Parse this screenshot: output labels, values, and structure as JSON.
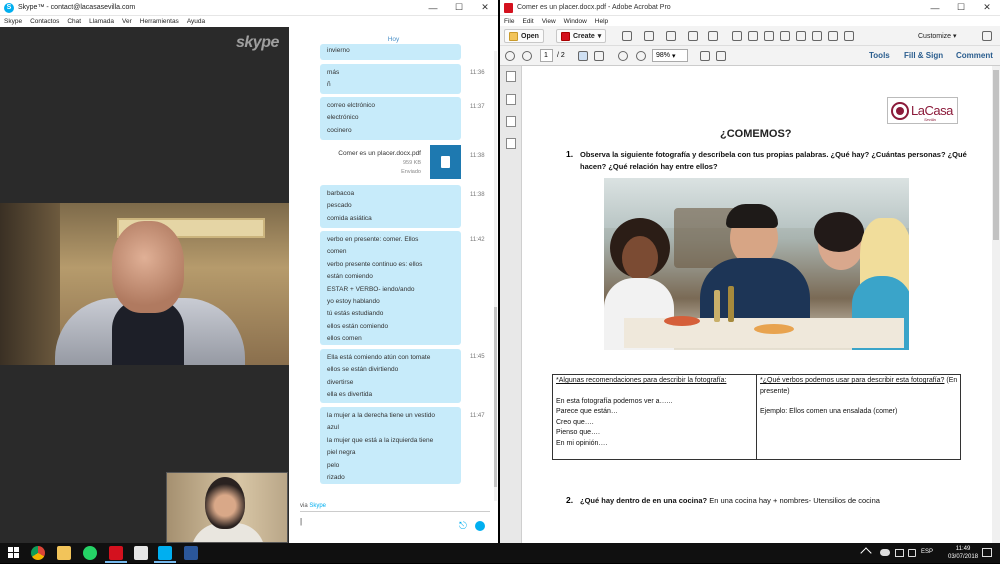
{
  "skype": {
    "title": "Skype™ - contact@lacasasevilla.com",
    "window_controls": [
      "—",
      "☐",
      "✕"
    ],
    "menu": [
      "Skype",
      "Contactos",
      "Chat",
      "Llamada",
      "Ver",
      "Herramientas",
      "Ayuda"
    ],
    "logo_text": "skype",
    "day_label": "Hoy",
    "messages": [
      {
        "lines": [
          "invierno"
        ],
        "time": ""
      },
      {
        "lines": [
          "más",
          "ñ"
        ],
        "time": "11:36"
      },
      {
        "lines": [
          "correo elctrónico",
          "electrónico",
          "cocinero"
        ],
        "time": "11:37"
      },
      {
        "lines": [
          "barbacoa",
          "pescado",
          "comida asiática"
        ],
        "time": "11:38"
      },
      {
        "lines": [
          "verbo en presente: comer. Ellos",
          "comen",
          "verbo presente continuo es: ellos",
          "están comiendo",
          "ESTAR + VERBO- iendo/ando",
          "yo estoy hablando",
          "tú estás estudiando",
          "ellos están comiendo",
          "ellos comen"
        ],
        "time": "11:42"
      },
      {
        "lines": [
          "Ella está comiendo atún con tomate",
          "ellos se están divirtiendo",
          "divertirse",
          "ella es divertida"
        ],
        "time": "11:45"
      },
      {
        "lines": [
          "la mujer a la derecha tiene un vestido",
          "azul",
          "la mujer que está a la izquierda tiene",
          "piel negra",
          "pelo",
          "rizado"
        ],
        "time": "11:47"
      }
    ],
    "file": {
      "name": "Comer es un placer.docx.pdf",
      "size": "959 KB",
      "status": "Enviado",
      "time": "11:38"
    },
    "via_prefix": "via",
    "via_link": "Skype",
    "input_value": "|"
  },
  "acrobat": {
    "title": "Comer es un placer.docx.pdf - Adobe Acrobat Pro",
    "window_controls": [
      "—",
      "☐",
      "✕"
    ],
    "menu": [
      "File",
      "Edit",
      "View",
      "Window",
      "Help"
    ],
    "toolbar": {
      "open": "Open",
      "create": "Create",
      "customize": "Customize"
    },
    "page_current": "1",
    "page_total": "/ 2",
    "zoom": "98%",
    "right_links": [
      "Tools",
      "Fill & Sign",
      "Comment"
    ],
    "document": {
      "logo": "LaCasa",
      "logo_sub": "Sevilla",
      "title": "¿COMEMOS?",
      "q1_num": "1.",
      "q1_line1": "Observa la siguiente fotografía y descríbela con tus propias palabras. ¿Qué hay? ¿Cuántas personas? ¿Qué",
      "q1_line2": "hacen? ¿Qué relación hay entre ellos?",
      "table_left_heading": "*Algunas recomendaciones para describir la fotografía:",
      "table_left_lines": [
        "En esta fotografía podemos ver a…...",
        "Parece que están…",
        "Creo que….",
        "Pienso que….",
        "En mi opinión…."
      ],
      "table_right_heading": "*¿Qué verbos podemos usar para describir esta fotografía?",
      "table_right_heading_suffix": "(En presente)",
      "table_right_example": "Ejemplo: Ellos comen una ensalada (comer)",
      "q2_num": "2.",
      "q2_bold": "¿Qué hay dentro de en una cocina?",
      "q2_rest": "En una cocina hay + nombres- Utensilios de cocina"
    }
  },
  "taskbar": {
    "lang": "ESP",
    "time": "11:49",
    "date": "03/07/2018"
  }
}
